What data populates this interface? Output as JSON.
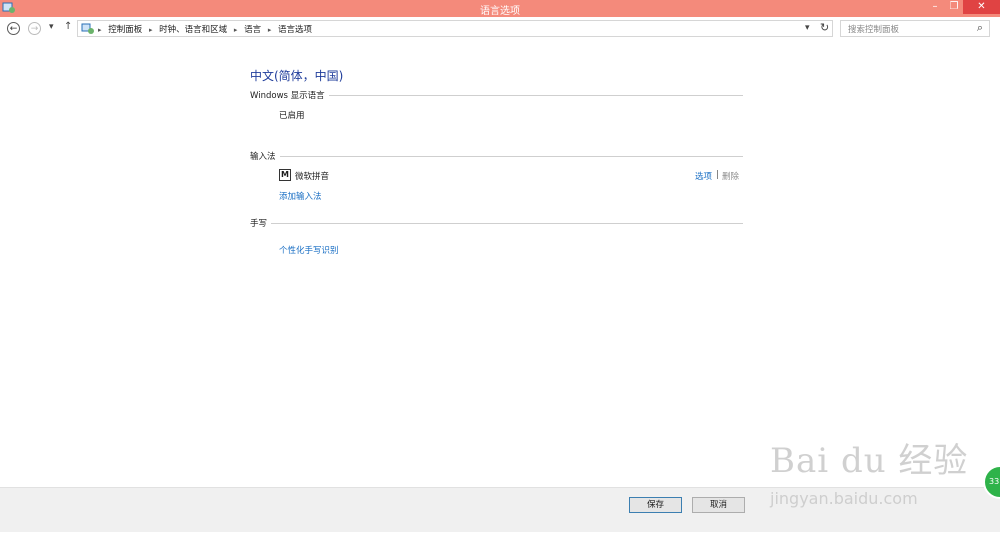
{
  "window": {
    "title": "语言选项",
    "min_glyph": "–",
    "max_glyph": "❐",
    "close_glyph": "✕"
  },
  "nav": {
    "back_glyph": "←",
    "forward_glyph": "→",
    "history_glyph": "▾",
    "up_glyph": "↑"
  },
  "address": {
    "crumbs": [
      "控制面板",
      "时钟、语言和区域",
      "语言",
      "语言选项"
    ],
    "sep_glyph": "▸",
    "dropdown_glyph": "▾",
    "refresh_glyph": "↻"
  },
  "search": {
    "placeholder": "搜索控制面板",
    "icon_glyph": "⌕"
  },
  "main": {
    "heading": "中文(简体，中国)",
    "display_language": {
      "label": "Windows 显示语言",
      "status": "已启用"
    },
    "input_method": {
      "label": "输入法",
      "ime_icon_text": "M",
      "ime_name": "微软拼音",
      "options_link": "选项",
      "divider": "|",
      "remove_link": "删除",
      "add_link": "添加输入法"
    },
    "handwriting": {
      "label": "手写",
      "personalize_link": "个性化手写识别"
    }
  },
  "footer": {
    "save_label": "保存",
    "cancel_label": "取消"
  },
  "watermark": {
    "main": "Bai du 经验",
    "sub": "jingyan.baidu.com"
  },
  "badge": {
    "text": "33"
  },
  "colors": {
    "titlebar": "#f48a7b",
    "close_button": "#e04343",
    "heading": "#1f3c9b",
    "link": "#1a6fc4"
  }
}
